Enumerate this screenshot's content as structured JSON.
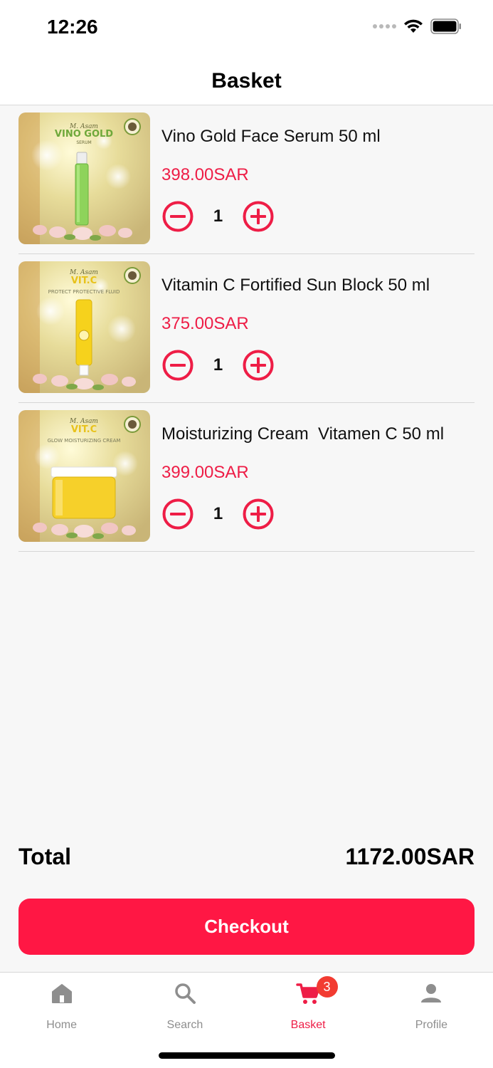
{
  "status_bar": {
    "time": "12:26"
  },
  "header": {
    "title": "Basket"
  },
  "colors": {
    "accent": "#ff1744",
    "price": "#ee1d46",
    "badge": "#f23b31"
  },
  "items": [
    {
      "name": "Vino Gold Face Serum 50 ml",
      "price": "398.00SAR",
      "quantity": "1",
      "image": {
        "brand": "M. Asam",
        "title": "VINO GOLD",
        "subtitle": "SERUM"
      }
    },
    {
      "name": "Vitamin C Fortified Sun Block 50 ml",
      "price": "375.00SAR",
      "quantity": "1",
      "image": {
        "brand": "M. Asam",
        "title": "VIT.C",
        "subtitle": "PROTECT PROTECTIVE FLUID"
      }
    },
    {
      "name": "Moisturizing Cream  Vitamen C 50 ml",
      "price": "399.00SAR",
      "quantity": "1",
      "image": {
        "brand": "M. Asam",
        "title": "VIT.C",
        "subtitle": "GLOW MOISTURIZING CREAM"
      }
    }
  ],
  "summary": {
    "total_label": "Total",
    "total_value": "1172.00SAR"
  },
  "checkout": {
    "label": "Checkout"
  },
  "tabs": [
    {
      "label": "Home",
      "icon": "home-icon"
    },
    {
      "label": "Search",
      "icon": "search-icon"
    },
    {
      "label": "Basket",
      "icon": "cart-icon",
      "badge": "3",
      "active": true
    },
    {
      "label": "Profile",
      "icon": "person-icon"
    }
  ]
}
